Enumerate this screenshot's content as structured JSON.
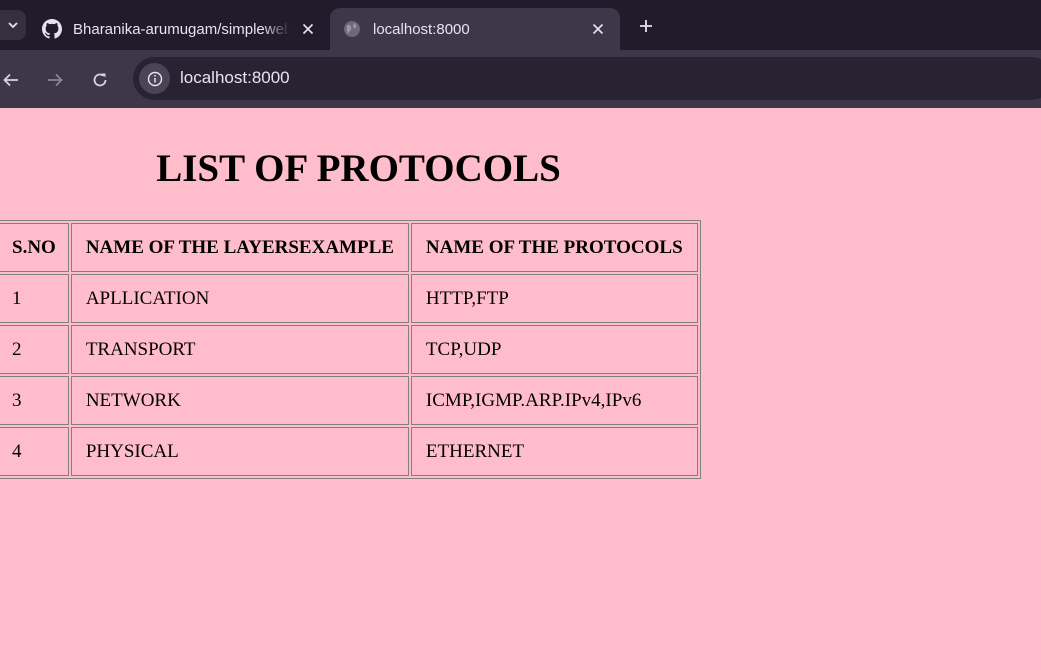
{
  "browser": {
    "tabs": [
      {
        "title": "Bharanika-arumugam/simplewebserver",
        "favicon": "github-icon",
        "active": false
      },
      {
        "title": "localhost:8000",
        "favicon": "globe-icon",
        "active": true
      }
    ],
    "url": "localhost:8000"
  },
  "page": {
    "heading": "LIST OF PROTOCOLS",
    "table": {
      "headers": [
        "S.NO",
        "NAME OF THE LAYERSEXAMPLE",
        "NAME OF THE PROTOCOLS"
      ],
      "rows": [
        [
          "1",
          "APLLICATION",
          "HTTP,FTP"
        ],
        [
          "2",
          "TRANSPORT",
          "TCP,UDP"
        ],
        [
          "3",
          "NETWORK",
          "ICMP,IGMP.ARP.IPv4,IPv6"
        ],
        [
          "4",
          "PHYSICAL",
          "ETHERNET"
        ]
      ]
    }
  },
  "colors": {
    "page_background": "#ffbccb",
    "browser_frame": "#211c2b",
    "toolbar": "#3d3749"
  }
}
